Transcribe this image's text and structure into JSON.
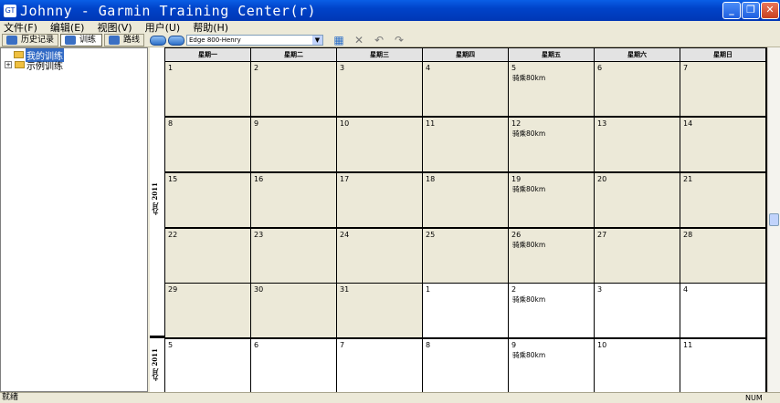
{
  "window": {
    "title": "Johnny - Garmin Training Center(r)",
    "icon": "garmin-app-icon"
  },
  "window_controls": {
    "minimize": "_",
    "maximize": "❐",
    "close": "✕"
  },
  "menu": [
    "文件(F)",
    "编辑(E)",
    "视图(V)",
    "用户(U)",
    "帮助(H)"
  ],
  "tabs": [
    {
      "label": "历史记录",
      "icon": "history-icon",
      "color": "#3a6fc4"
    },
    {
      "label": "训练",
      "icon": "training-icon",
      "color": "#3a6fc4"
    },
    {
      "label": "路线",
      "icon": "course-icon",
      "color": "#3a6fc4"
    }
  ],
  "device": {
    "selected": "Edge 800-Henry"
  },
  "tree": {
    "expander": "+",
    "items": [
      {
        "label": "我的训练",
        "selected": true
      },
      {
        "label": "示例训练",
        "selected": false
      }
    ]
  },
  "calendar": {
    "weekdays": [
      "星期一",
      "星期二",
      "星期三",
      "星期四",
      "星期五",
      "星期六",
      "星期日"
    ],
    "months": [
      "九月 2011",
      "九月 2011"
    ],
    "weeks": [
      [
        {
          "day": "",
          "event": ""
        },
        {
          "day": "",
          "event": ""
        },
        {
          "day": "",
          "event": ""
        },
        {
          "day": "",
          "event": ""
        },
        {
          "day": "",
          "event": ""
        },
        {
          "day": "",
          "event": ""
        },
        {
          "day": "",
          "event": ""
        }
      ]
    ],
    "rows": [
      [
        [
          "1",
          ""
        ],
        [
          "2",
          ""
        ],
        [
          "3",
          ""
        ],
        [
          "4",
          ""
        ],
        [
          "5",
          "骑乘80km"
        ],
        [
          "6",
          ""
        ],
        [
          "7",
          ""
        ]
      ],
      [
        [
          "8",
          ""
        ],
        [
          "9",
          ""
        ],
        [
          "10",
          ""
        ],
        [
          "11",
          ""
        ],
        [
          "12",
          "骑乘80km"
        ],
        [
          "13",
          ""
        ],
        [
          "14",
          ""
        ]
      ],
      [
        [
          "15",
          ""
        ],
        [
          "16",
          ""
        ],
        [
          "17",
          ""
        ],
        [
          "18",
          ""
        ],
        [
          "19",
          "骑乘80km"
        ],
        [
          "20",
          ""
        ],
        [
          "21",
          ""
        ]
      ],
      [
        [
          "22",
          ""
        ],
        [
          "23",
          ""
        ],
        [
          "24",
          ""
        ],
        [
          "25",
          ""
        ],
        [
          "26",
          "骑乘80km"
        ],
        [
          "27",
          ""
        ],
        [
          "28",
          ""
        ]
      ],
      [
        [
          "29",
          ""
        ],
        [
          "30",
          ""
        ],
        [
          "31",
          ""
        ],
        [
          "1",
          ""
        ],
        [
          "2",
          "骑乘80km"
        ],
        [
          "3",
          ""
        ],
        [
          "4",
          ""
        ]
      ],
      [
        [
          "5",
          ""
        ],
        [
          "6",
          ""
        ],
        [
          "7",
          ""
        ],
        [
          "8",
          ""
        ],
        [
          "9",
          "骑乘80km"
        ],
        [
          "10",
          ""
        ],
        [
          "11",
          ""
        ]
      ]
    ],
    "next_month_from": [
      4,
      3
    ],
    "colors": {
      "current": "#ece9d8",
      "next": "#ffffff"
    }
  },
  "status": {
    "text": "就绪",
    "num": "NUM"
  }
}
